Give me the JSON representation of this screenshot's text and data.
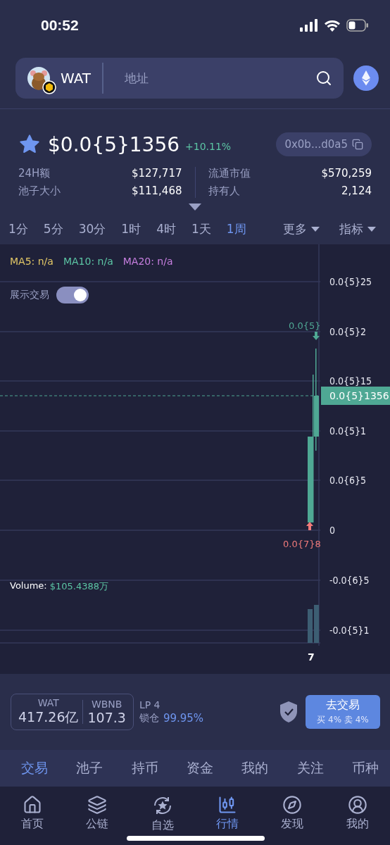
{
  "status_bar": {
    "time": "00:52"
  },
  "search": {
    "token": "WAT",
    "placeholder": "地址"
  },
  "token": {
    "favorite": true,
    "price": "$0.0{5}1356",
    "change": "+10.11%",
    "address": "0x0b...d0a5"
  },
  "stats": {
    "left": [
      {
        "label": "24H额",
        "value": "$127,717"
      },
      {
        "label": "池子大小",
        "value": "$111,468"
      }
    ],
    "right": [
      {
        "label": "流通市值",
        "value": "$570,259"
      },
      {
        "label": "持有人",
        "value": "2,124"
      }
    ]
  },
  "timeframes": [
    {
      "label": "1分",
      "selected": false
    },
    {
      "label": "5分",
      "selected": false
    },
    {
      "label": "30分",
      "selected": false
    },
    {
      "label": "1时",
      "selected": false
    },
    {
      "label": "4时",
      "selected": false
    },
    {
      "label": "1天",
      "selected": false
    },
    {
      "label": "1周",
      "selected": true
    }
  ],
  "menus": [
    {
      "label": "更多"
    },
    {
      "label": "指标"
    }
  ],
  "chart": {
    "ma": [
      {
        "label": "MA5: n/a",
        "color": "#e2c766"
      },
      {
        "label": "MA10: n/a",
        "color": "#5cc5a4"
      },
      {
        "label": "MA20: n/a",
        "color": "#c77fe0"
      }
    ],
    "show_trades": {
      "label": "展示交易",
      "on": true
    },
    "y_labels": [
      "0.0{5}25",
      "0.0{5}2",
      "0.0{5}15",
      "0.0{5}1",
      "0.0{6}5",
      "0",
      "-0.0{6}5",
      "-0.0{5}1"
    ],
    "price_tag": "0.0{5}1356",
    "high_label": "0.0{5}",
    "low_label": "0.0{7}8",
    "volume_label": "Volume:",
    "volume_value": "$105.4388万",
    "x_label": "7"
  },
  "pool": {
    "base": {
      "symbol": "WAT",
      "amount": "417.26亿"
    },
    "quote": {
      "symbol": "WBNB",
      "amount": "107.3"
    },
    "lp": "LP 4",
    "lock_label": "锁仓",
    "lock_value": "99.95%"
  },
  "trade_button": {
    "label": "去交易",
    "fees": "买 4% 卖 4%"
  },
  "section_tabs": [
    {
      "label": "交易",
      "selected": true
    },
    {
      "label": "池子",
      "selected": false
    },
    {
      "label": "持币",
      "selected": false
    },
    {
      "label": "资金",
      "selected": false
    },
    {
      "label": "我的",
      "selected": false
    },
    {
      "label": "关注",
      "selected": false
    },
    {
      "label": "币种",
      "selected": false
    }
  ],
  "nav": [
    {
      "kind": "home",
      "label": "首页",
      "selected": false
    },
    {
      "kind": "chains",
      "label": "公链",
      "selected": false
    },
    {
      "kind": "watchlist",
      "label": "自选",
      "selected": false
    },
    {
      "kind": "market",
      "label": "行情",
      "selected": true
    },
    {
      "kind": "discover",
      "label": "发现",
      "selected": false
    },
    {
      "kind": "profile",
      "label": "我的",
      "selected": false
    }
  ]
}
